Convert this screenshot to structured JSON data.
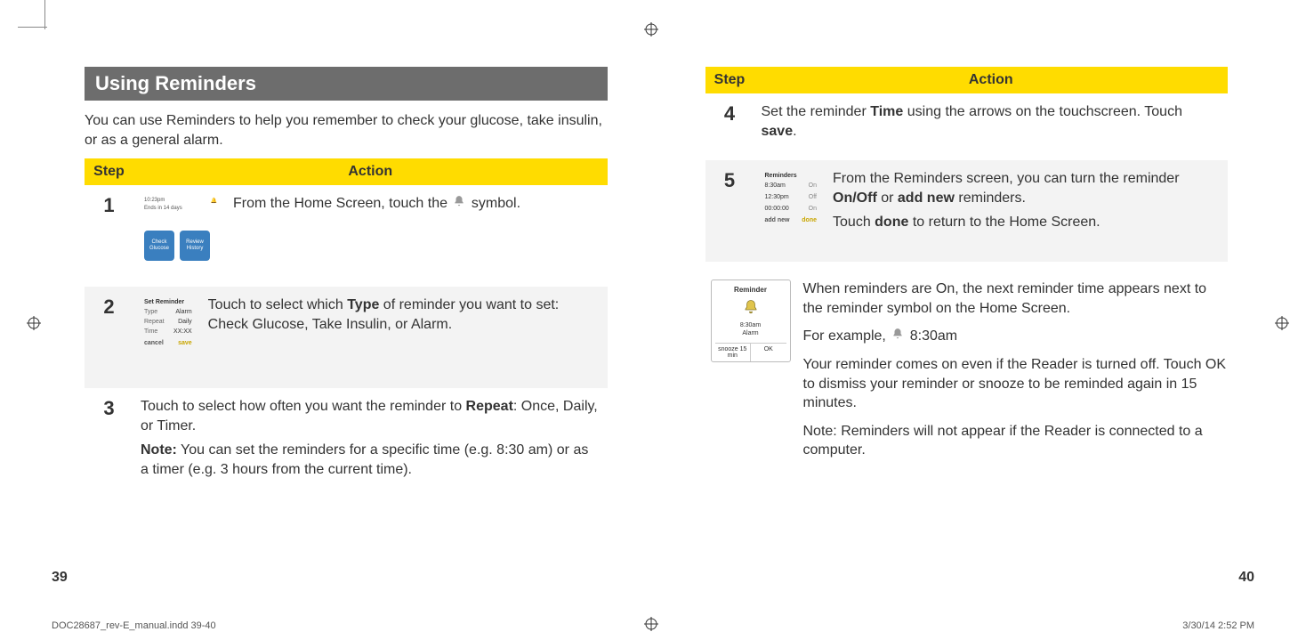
{
  "crop": {
    "present": true
  },
  "left": {
    "title": "Using Reminders",
    "intro": "You can use Reminders to help you remember to check your glucose, take insulin, or as a general alarm.",
    "header_step": "Step",
    "header_action": "Action",
    "rows": {
      "r1": {
        "num": "1",
        "mock_time": "10:23pm",
        "mock_sensor": "Ends in 14 days",
        "tile1": "Check Glucose",
        "tile2": "Review History",
        "text_pre": "From the Home Screen, touch the ",
        "text_post": " symbol."
      },
      "r2": {
        "num": "2",
        "mock_title": "Set Reminder",
        "l_type": "Type",
        "v_type": "Alarm",
        "l_repeat": "Repeat",
        "v_repeat": "Daily",
        "l_time": "Time",
        "v_time": "XX:XX",
        "btn_cancel": "cancel",
        "btn_save": "save",
        "text_a": "Touch to select which ",
        "text_b": "Type",
        "text_c": " of reminder you want to set: Check Glucose, Take Insulin, or Alarm."
      },
      "r3": {
        "num": "3",
        "p1_a": "Touch to select how often you want the reminder to ",
        "p1_b": "Repeat",
        "p1_c": ": Once, Daily, or Timer.",
        "p2_a": "Note:",
        "p2_b": " You can set the reminders for a specific time (e.g. 8:30 am) or as a timer (e.g. 3 hours from the current time)."
      }
    },
    "page_num": "39"
  },
  "right": {
    "header_step": "Step",
    "header_action": "Action",
    "rows": {
      "r4": {
        "num": "4",
        "p_a": "Set the reminder ",
        "p_b": "Time",
        "p_c": " using the arrows on the touchscreen. Touch ",
        "p_d": "save",
        "p_e": "."
      },
      "r5": {
        "num": "5",
        "mock_title": "Reminders",
        "items": [
          {
            "t": "8:30am",
            "s": "On"
          },
          {
            "t": "12:30pm",
            "s": "Off"
          },
          {
            "t": "00:00:00",
            "s": "On"
          }
        ],
        "addnew": "add new",
        "done": "done",
        "p1_a": "From the Reminders screen, you can turn the reminder ",
        "p1_b": "On/Off",
        "p1_c": " or ",
        "p1_d": "add new",
        "p1_e": " reminders.",
        "p2_a": "Touch ",
        "p2_b": "done",
        "p2_c": " to return to the Home Screen."
      }
    },
    "popup": {
      "title": "Reminder",
      "line1": "8:30am",
      "line2": "Alarm",
      "snooze": "snooze 15 min",
      "ok": "OK"
    },
    "notes": {
      "n1": "When reminders are On, the next reminder time appears next to the reminder symbol on the Home Screen.",
      "n2_a": "For example, ",
      "n2_b": "8:30am",
      "n3_a": "Your reminder comes on even if the Reader is turned off. Touch ",
      "n3_b": "OK",
      "n3_c": " to dismiss your reminder or ",
      "n3_d": "snooze",
      "n3_e": " to be reminded again in 15 minutes.",
      "n4_a": "Note:",
      "n4_b": " Reminders will not appear if the Reader is connected to a computer."
    },
    "page_num": "40"
  },
  "footer": {
    "file": "DOC28687_rev-E_manual.indd   39-40",
    "stamp": "3/30/14   2:52 PM"
  }
}
